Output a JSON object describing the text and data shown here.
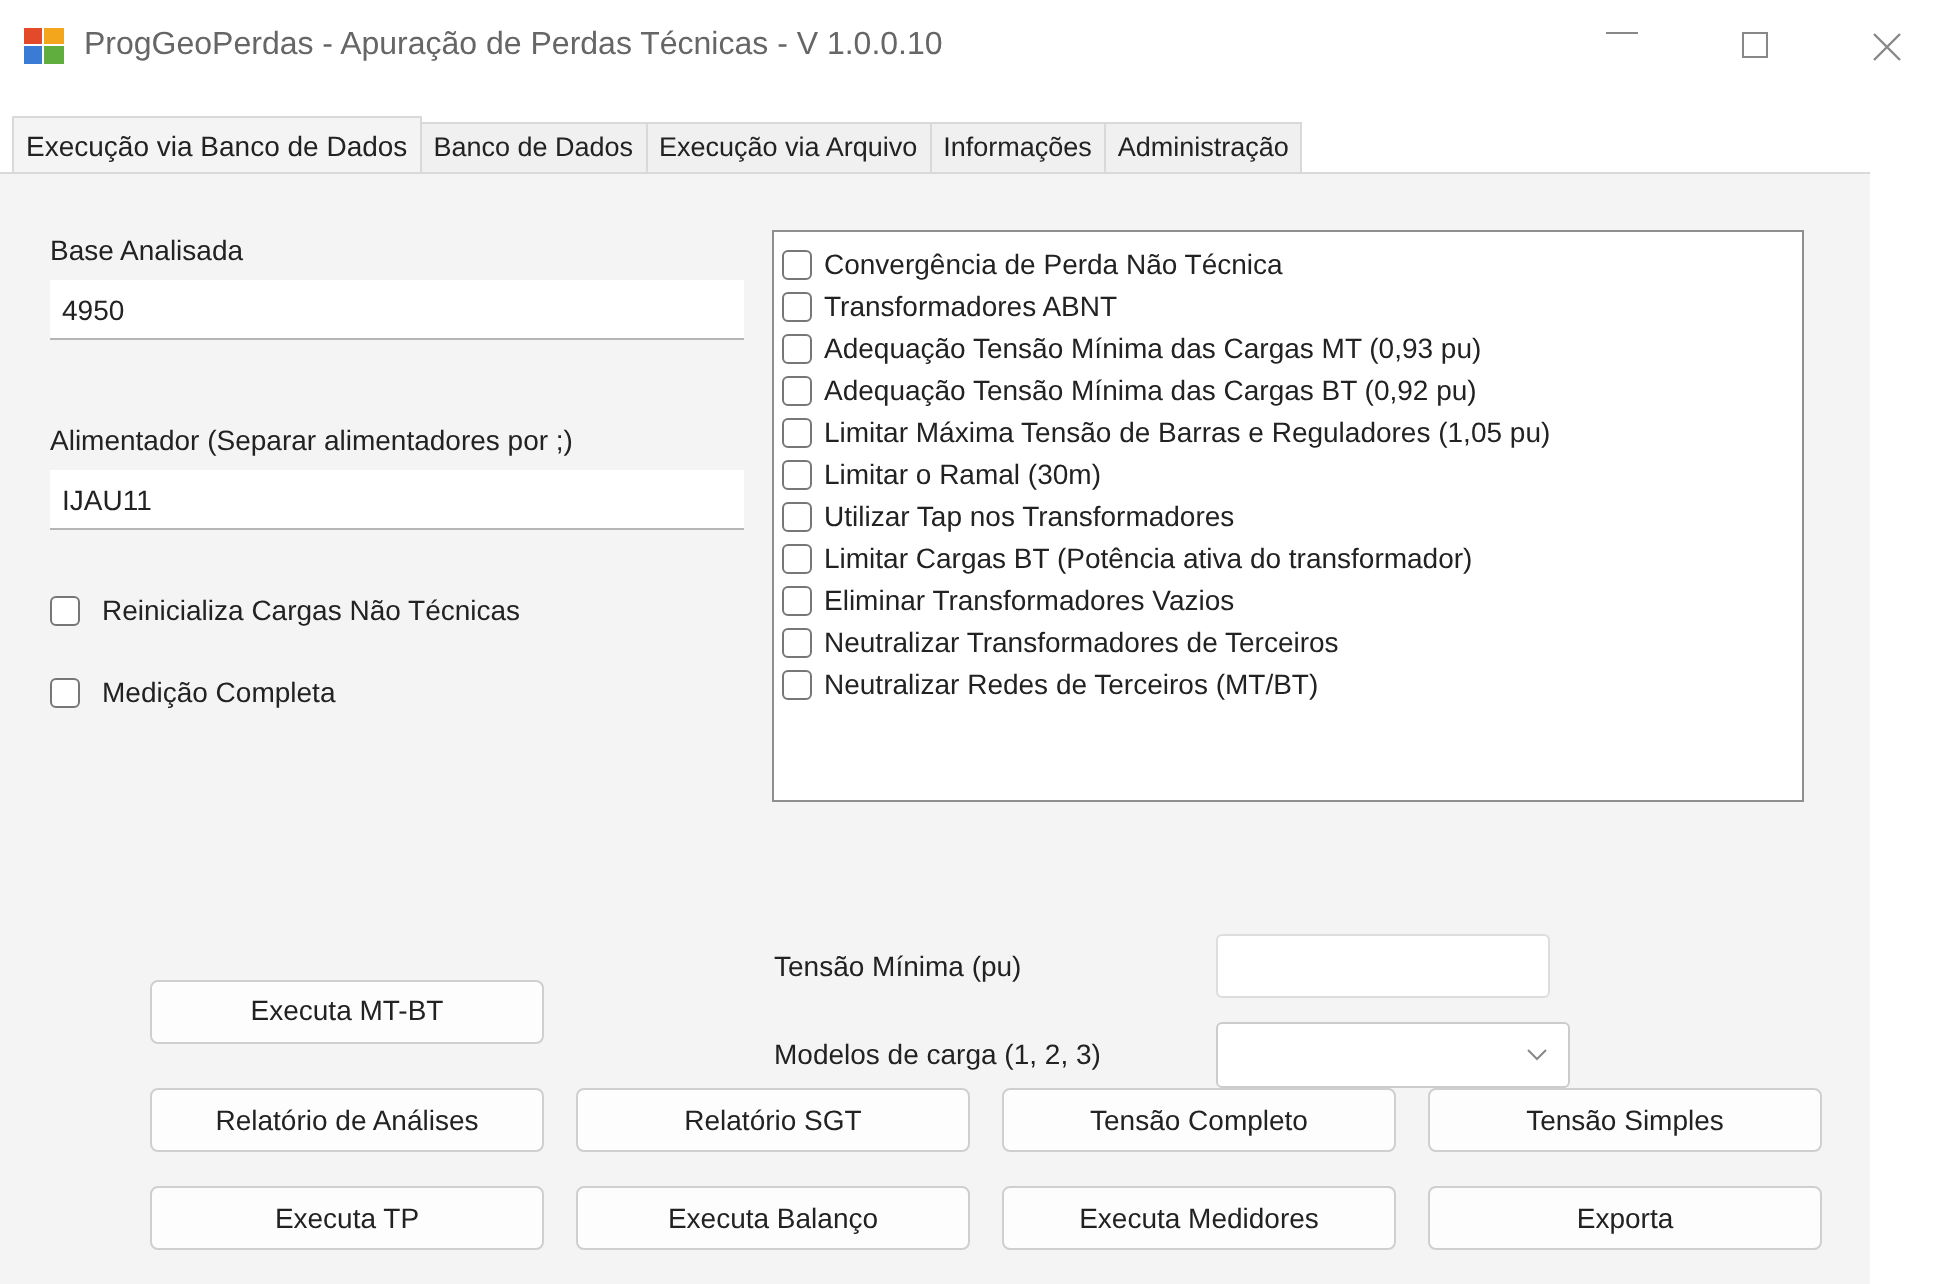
{
  "window": {
    "title": "ProgGeoPerdas - Apuração de Perdas Técnicas - V 1.0.0.10"
  },
  "tabs": [
    {
      "label": "Execução via Banco de Dados",
      "selected": true
    },
    {
      "label": "Banco de Dados",
      "selected": false
    },
    {
      "label": "Execução via Arquivo",
      "selected": false
    },
    {
      "label": "Informações",
      "selected": false
    },
    {
      "label": "Administração",
      "selected": false
    }
  ],
  "fields": [
    {
      "label": "Base Analisada",
      "value": "4950"
    },
    {
      "label": "Alimentador (Separar alimentadores por ;)",
      "value": "IJAU11"
    }
  ],
  "left_options": [
    {
      "label": "Reinicializa Cargas Não Técnicas",
      "checked": false
    },
    {
      "label": "Medição Completa",
      "checked": false
    }
  ],
  "options": [
    {
      "label": "Convergência de Perda Não Técnica",
      "checked": false
    },
    {
      "label": "Transformadores ABNT",
      "checked": false
    },
    {
      "label": "Adequação Tensão Mínima das Cargas MT (0,93 pu)",
      "checked": false
    },
    {
      "label": "Adequação Tensão Mínima das Cargas BT (0,92 pu)",
      "checked": false
    },
    {
      "label": "Limitar Máxima Tensão de Barras e Reguladores (1,05 pu)",
      "checked": false
    },
    {
      "label": "Limitar o Ramal (30m)",
      "checked": false
    },
    {
      "label": "Utilizar Tap nos Transformadores",
      "checked": false
    },
    {
      "label": "Limitar Cargas BT (Potência ativa do transformador)",
      "checked": false
    },
    {
      "label": "Eliminar Transformadores Vazios",
      "checked": false
    },
    {
      "label": "Neutralizar Transformadores de Terceiros",
      "checked": false
    },
    {
      "label": "Neutralizar Redes de Terceiros (MT/BT)",
      "checked": false
    }
  ],
  "tensao_minima": {
    "label": "Tensão Mínima (pu)"
  },
  "modelos_carga": {
    "label": "Modelos de carga (1, 2, 3)"
  },
  "run_button": "Executa MT-BT",
  "button_rows": [
    [
      "Relatório de Análises",
      "Relatório SGT",
      "Tensão Completo",
      "Tensão Simples"
    ],
    [
      "Executa TP",
      "Executa Balanço",
      "Executa Medidores",
      "Exporta"
    ]
  ]
}
